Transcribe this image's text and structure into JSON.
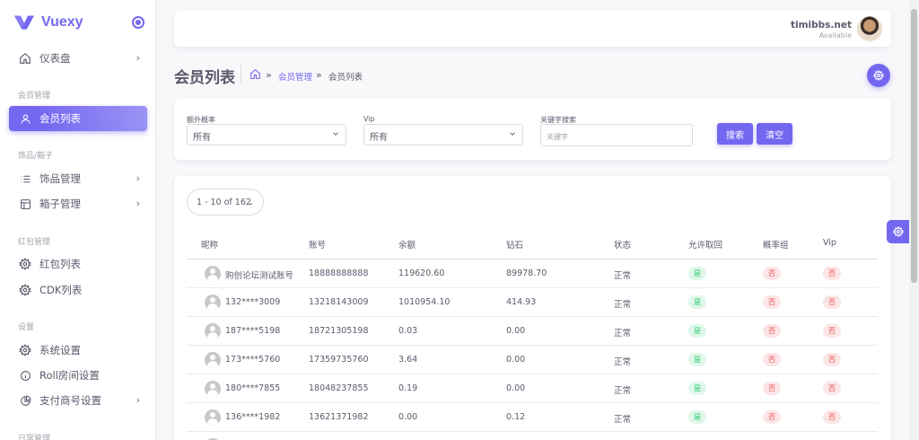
{
  "brand": {
    "name": "Vuexy"
  },
  "sidebar": {
    "dashboard": "仪表盘",
    "sections": [
      {
        "title": "会员管理"
      },
      {
        "title": "饰品/箱子"
      },
      {
        "title": "红包管理"
      },
      {
        "title": "设置"
      },
      {
        "title": "日常管理"
      }
    ],
    "items": [
      {
        "label": "会员列表"
      },
      {
        "label": "饰品管理"
      },
      {
        "label": "箱子管理"
      },
      {
        "label": "红包列表"
      },
      {
        "label": "CDK列表"
      },
      {
        "label": "系统设置"
      },
      {
        "label": "Roll房间设置"
      },
      {
        "label": "支付商号设置"
      }
    ]
  },
  "navbar": {
    "user_name": "timibbs.net",
    "user_status": "Available"
  },
  "page": {
    "title": "会员列表",
    "breadcrumb_sep": "»",
    "breadcrumb_link": "会员管理",
    "breadcrumb_current": "会员列表"
  },
  "filters": {
    "extra_rate_label": "额外概率",
    "extra_rate_value": "所有",
    "vip_label": "Vip",
    "vip_value": "所有",
    "keyword_label": "关键字搜索",
    "keyword_placeholder": "关键字",
    "search_button": "搜索",
    "clear_button": "清空"
  },
  "table": {
    "pager": "1 - 10 of 162",
    "columns": [
      "昵称",
      "账号",
      "余额",
      "钻石",
      "状态",
      "允许取回",
      "概率组",
      "Vip"
    ],
    "rows": [
      {
        "nickname": "购创论坛测试账号",
        "account": "18888888888",
        "balance": "119620.60",
        "diamond": "89978.70",
        "status": "正常",
        "allow": "是",
        "rate_group": "否",
        "vip": "否"
      },
      {
        "nickname": "132****3009",
        "account": "13218143009",
        "balance": "1010954.10",
        "diamond": "414.93",
        "status": "正常",
        "allow": "是",
        "rate_group": "否",
        "vip": "否"
      },
      {
        "nickname": "187****5198",
        "account": "18721305198",
        "balance": "0.03",
        "diamond": "0.00",
        "status": "正常",
        "allow": "是",
        "rate_group": "否",
        "vip": "否"
      },
      {
        "nickname": "173****5760",
        "account": "17359735760",
        "balance": "3.64",
        "diamond": "0.00",
        "status": "正常",
        "allow": "是",
        "rate_group": "否",
        "vip": "否"
      },
      {
        "nickname": "180****7855",
        "account": "18048237855",
        "balance": "0.19",
        "diamond": "0.00",
        "status": "正常",
        "allow": "是",
        "rate_group": "否",
        "vip": "否"
      },
      {
        "nickname": "136****1982",
        "account": "13621371982",
        "balance": "0.00",
        "diamond": "0.12",
        "status": "正常",
        "allow": "是",
        "rate_group": "否",
        "vip": "否"
      }
    ]
  },
  "colors": {
    "primary": "#7367f0",
    "success": "#28c76f",
    "danger": "#ea5455"
  }
}
